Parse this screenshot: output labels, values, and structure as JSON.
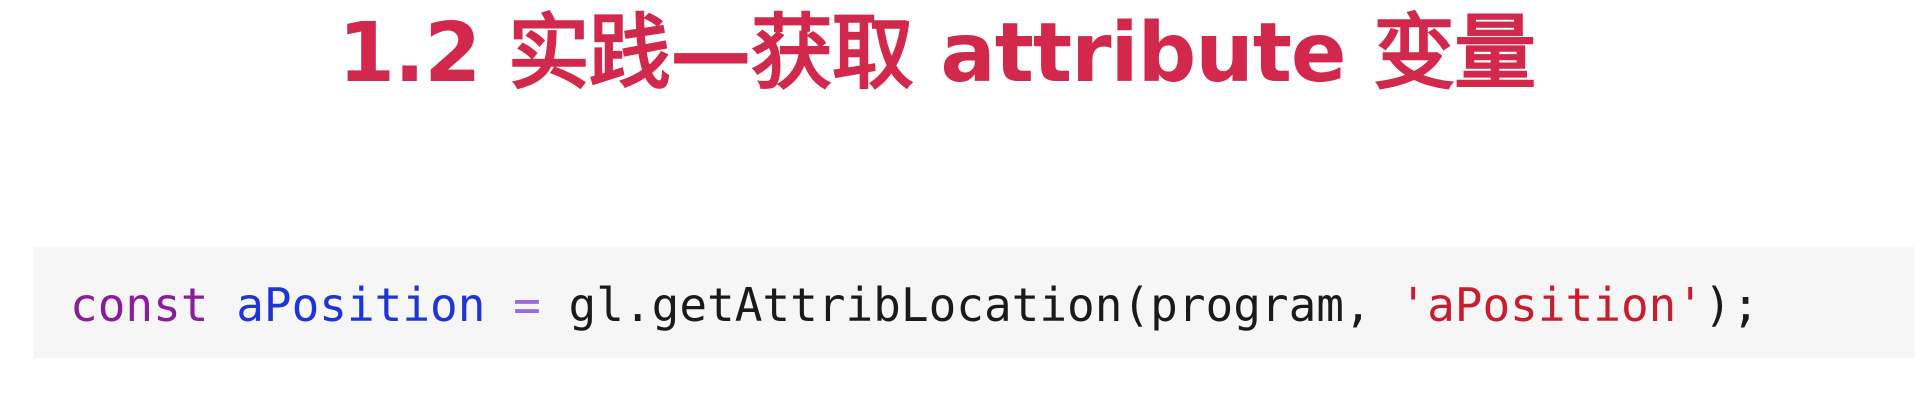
{
  "slide": {
    "title": "1.2 实践—获取 attribute 变量"
  },
  "code": {
    "keyword": "const",
    "space1": " ",
    "variable": "aPosition",
    "space2": " ",
    "operator": "=",
    "space3": " ",
    "call": "gl.getAttribLocation(program, ",
    "string": "'aPosition'",
    "end": ");"
  },
  "colors": {
    "title": "#d1284c",
    "keyword": "#8a1d99",
    "variable": "#1d34d6",
    "operator": "#9a6ae0",
    "string": "#c81c2f",
    "code_background": "#f6f6f6"
  }
}
